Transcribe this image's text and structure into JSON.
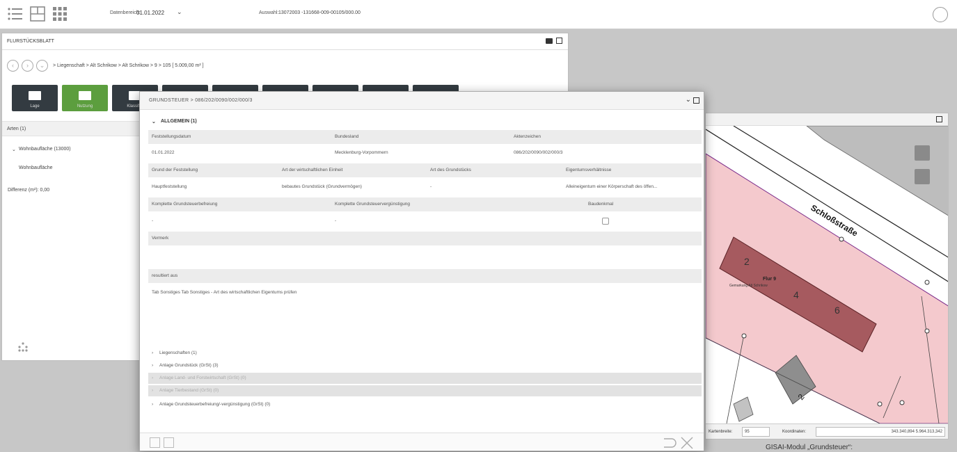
{
  "topbar": {
    "date_label": "Datenbereich:",
    "date_value": "01.01.2022",
    "auswahl_label": "Auswahl:",
    "auswahl_value": "13072003 -131668-009-00105/000.00"
  },
  "flst": {
    "title": "FLURSTÜCKSBLATT",
    "breadcrumb": "> Liegenschaft > Alt Schrikow > Alt Schrikow > 9 > 105 [ 5.009,00 m² ]",
    "tiles": [
      {
        "label": "Lage"
      },
      {
        "label": "Nutzung"
      },
      {
        "label": "Klassifizi"
      },
      {
        "label": ""
      },
      {
        "label": ""
      },
      {
        "label": ""
      },
      {
        "label": ""
      },
      {
        "label": ""
      },
      {
        "label": ""
      }
    ],
    "arten_label": "Arten (1)",
    "item_group": "Wohnbaufläche (13000)",
    "item_sub": "Wohnbaufläche",
    "differenz": "Differenz (m²): 0,00"
  },
  "dialog": {
    "title": "GRUNDSTEUER > 086/202/0090/002/000/3",
    "section_label": "ALLGEMEIN (1)",
    "row1_headers": [
      "Feststellungsdatum",
      "Bundesland",
      "Aktenzeichen"
    ],
    "row1_values": [
      "01.01.2022",
      "Mecklenburg-Vorpommern",
      "086/202/0090/002/000/3"
    ],
    "row2_headers": [
      "Grund der Feststellung",
      "Art der wirtschaftlichen Einheit",
      "Art des Grundstücks",
      "Eigentumsverhältnisse"
    ],
    "row2_values": [
      "Hauptfeststellung",
      "bebautes Grundstück (Grundvermögen)",
      "-",
      "Alleineigentum einer Körperschaft des öffen..."
    ],
    "row3_headers": [
      "Komplette Grundsteuerbefreiung",
      "Komplette Grundsteuervergünstigung",
      "Baudenkmal"
    ],
    "row3_values": [
      "-",
      "-"
    ],
    "vermerk_label": "Vermerk",
    "resultiert_label": "resultiert aus",
    "resultiert_value": "Tab Sonstiges Tab Sonstiges - Art des wirtschaftlichen Eigentums prüfen",
    "subsections": [
      {
        "label": "Liegenschaften (1)",
        "style": "normal"
      },
      {
        "label": "Anlage Grundstück (GrSt) (3)",
        "style": "normal"
      },
      {
        "label": "Anlage Land- und Forstwirtschaft (GrSt) (0)",
        "style": "dim"
      },
      {
        "label": "Anlage Tierbestand (GrSt) (0)",
        "style": "dim"
      },
      {
        "label": "Anlage Grundsteuerbefreiung/-vergünstigung (GrSt) (0)",
        "style": "normal"
      }
    ]
  },
  "map": {
    "street_label": "Schloßstraße",
    "flur_label": "Flur 9",
    "flur_sub": "Gemarkung Alt Schrikow",
    "house_numbers": [
      "2",
      "4",
      "6",
      "2"
    ],
    "footer_scale_label": "Kartenbreite:",
    "footer_scale_value": "95",
    "footer_coord_label": "Koordinaten:",
    "footer_coord_value": "343.340,894 5.964.313,342"
  },
  "caption": "GISAI-Modul „Grundsteuer“:",
  "colors": {
    "accent_green": "#5c9e3e",
    "tile_dark": "#333b41",
    "parcel_fill": "#f4c9cd",
    "building_fill": "#a65a5f"
  }
}
